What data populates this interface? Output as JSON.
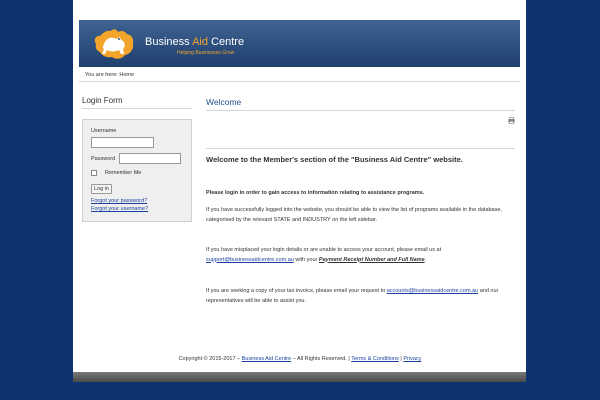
{
  "brand": {
    "name_part1": "Business ",
    "name_accent": "Aid",
    "name_part2": " Centre",
    "tagline": "Helping Businesses Grow",
    "accent_color": "#f3a52b",
    "background_color": "#0d3470",
    "header_color": "#2f5282"
  },
  "breadcrumb": {
    "prefix": "You are here:",
    "current": "Home"
  },
  "login": {
    "title": "Login Form",
    "username_label": "Username",
    "username_value": "",
    "password_label": "Password",
    "password_value": "",
    "remember_label": "Remember Me",
    "remember_checked": false,
    "submit_label": "Log in",
    "forgot_password": "Forgot your password?",
    "forgot_username": "Forgot your username?"
  },
  "article": {
    "title": "Welcome",
    "print_icon": "print-icon",
    "heading": "Welcome to the Member's section of the \"Business Aid Centre\" website.",
    "intro_bold": "Please login in order to gain access to information relating to assistance programs.",
    "p1_line1": "If you have successfully logged into the website, you should be able to view the list of programs available in the database,",
    "p1_line2": "categorised by the relevant STATE and INDUSTRY on the left sidebar.",
    "p2_line1": "If you have misplaced your login details or are unable to access your account, please email us at",
    "p2_email": "support@businessaidcentre.com.au",
    "p2_mid": " with your ",
    "p2_emphasis": "Payment Receipt Number and Full Name",
    "p2_end": ".",
    "p3_line1_pre": "If you are seeking a copy of your tax invoice, please email your request to ",
    "p3_email": "accounts@businessaidcentre.com.au",
    "p3_line1_post": " and our",
    "p3_line2": "representatives will be able to assist you."
  },
  "footer": {
    "copyright": "Copyright © 2015-2017 – ",
    "brand_link": "Business Aid Centre",
    "rights": " – All Rights Reserved. | ",
    "terms_link": "Terms & Conditions",
    "sep": " | ",
    "privacy_link": "Privacy"
  }
}
